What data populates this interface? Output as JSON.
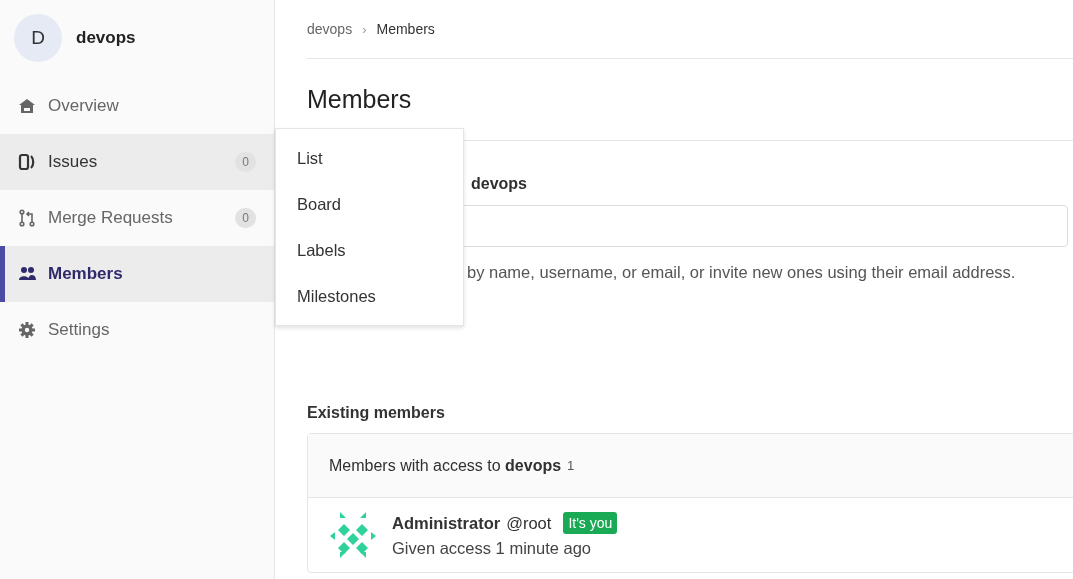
{
  "sidebar": {
    "avatar_letter": "D",
    "group_name": "devops",
    "items": [
      {
        "label": "Overview",
        "selected": false,
        "hovered": false
      },
      {
        "label": "Issues",
        "count": "0",
        "selected": false,
        "hovered": true
      },
      {
        "label": "Merge Requests",
        "count": "0",
        "selected": false,
        "hovered": false
      },
      {
        "label": "Members",
        "selected": true,
        "hovered": false
      },
      {
        "label": "Settings",
        "selected": false,
        "hovered": false
      }
    ]
  },
  "flyout_menu": {
    "items": [
      "List",
      "Board",
      "Labels",
      "Milestones"
    ]
  },
  "breadcrumb": [
    "devops",
    "Members"
  ],
  "breadcrumb_separator": "›",
  "page_title": "Members",
  "invite": {
    "heading": "**devops**",
    "hint": "by name, username, or email, or invite new ones using their email address."
  },
  "existing": {
    "title": "Existing members",
    "header": "Members with access to **devops**",
    "count": "1",
    "members": [
      {
        "name": "Administrator",
        "username": "@root",
        "badge": "It's you",
        "access": "Given access 1 minute ago"
      }
    ]
  }
}
